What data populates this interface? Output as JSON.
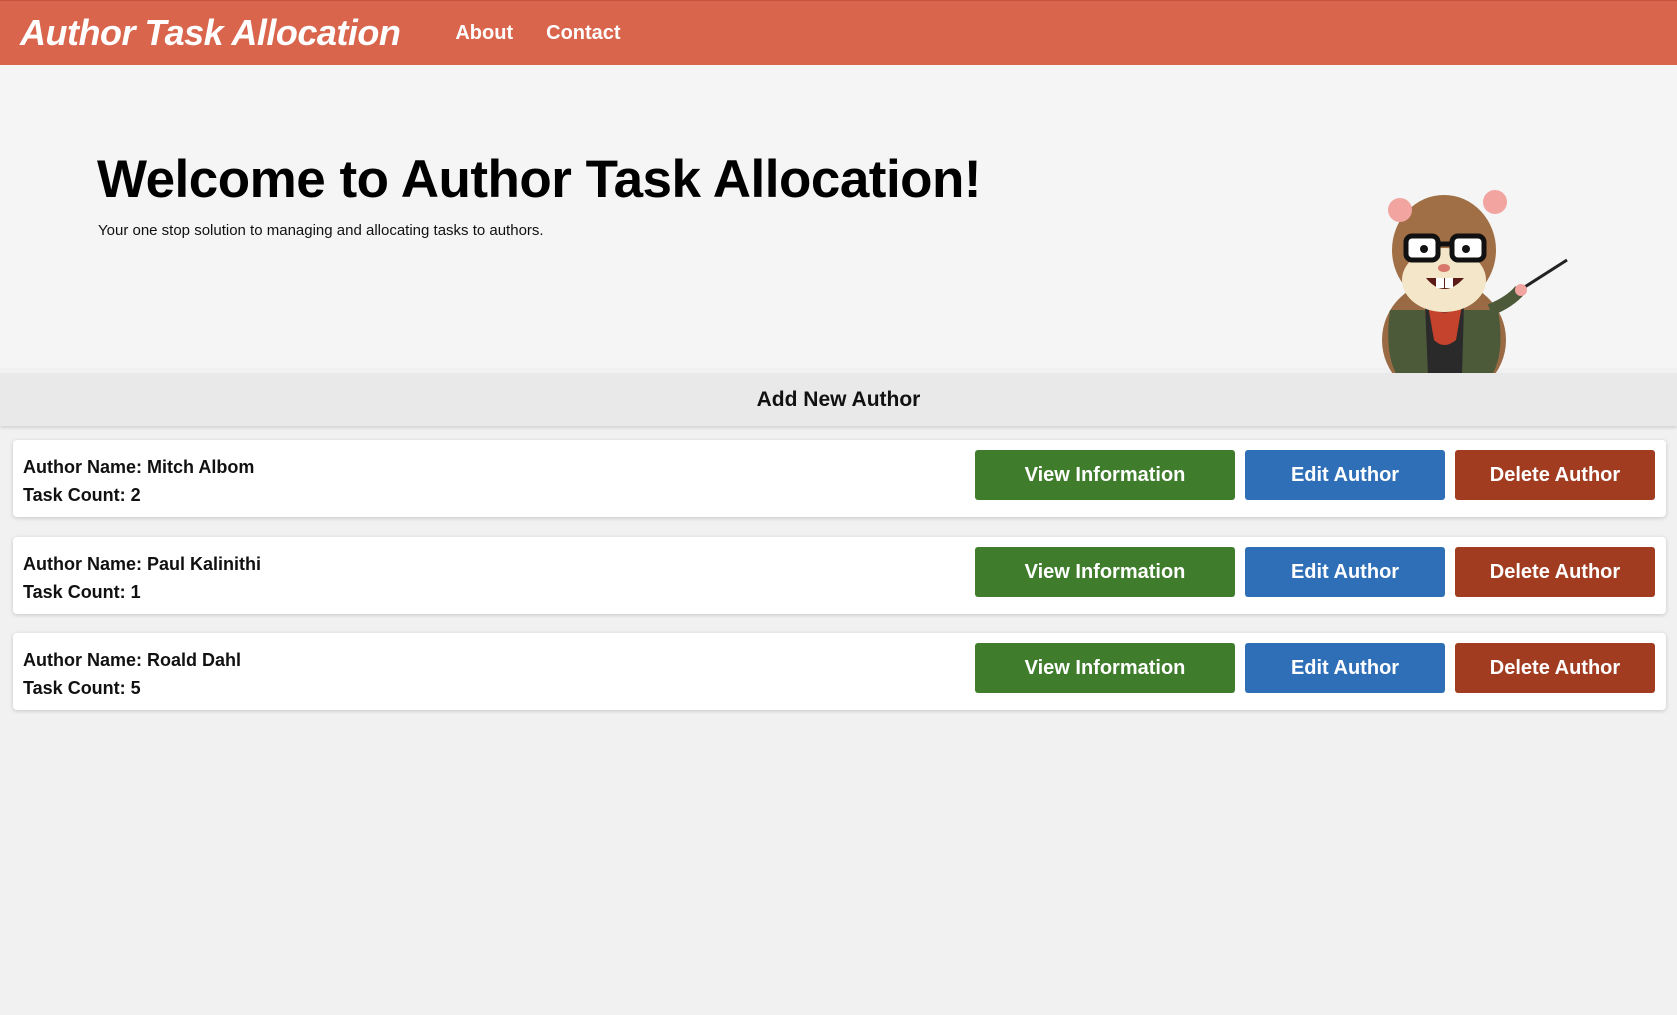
{
  "nav": {
    "brand": "Author Task Allocation",
    "links": [
      "About",
      "Contact"
    ]
  },
  "hero": {
    "title": "Welcome to Author Task Allocation!",
    "subtitle": "Your one stop solution to managing and allocating tasks to authors."
  },
  "add_author_label": "Add New Author",
  "authors": [
    {
      "name_line": "Author Name: Mitch Albom",
      "count_line": "Task Count: 2"
    },
    {
      "name_line": "Author Name: Paul Kalinithi",
      "count_line": "Task Count: 1"
    },
    {
      "name_line": "Author Name: Roald Dahl",
      "count_line": "Task Count: 5"
    }
  ],
  "buttons": {
    "view": "View Information",
    "edit": "Edit Author",
    "delete": "Delete Author"
  },
  "colors": {
    "navbar": "#d9654d",
    "view_button": "#3f7d2c",
    "edit_button": "#2f6fb8",
    "delete_button": "#a23c21"
  }
}
